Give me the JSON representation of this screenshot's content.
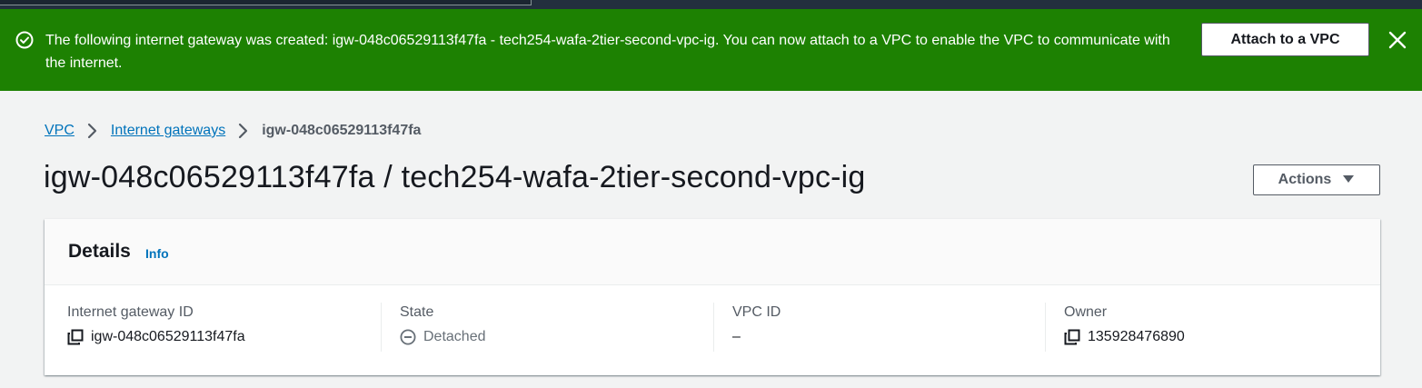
{
  "flash": {
    "message": "The following internet gateway was created: igw-048c06529113f47fa - tech254-wafa-2tier-second-vpc-ig. You can now attach to a VPC to enable the VPC to communicate with the internet.",
    "attach_label": "Attach to a VPC",
    "icon": "success-check-icon",
    "close_icon": "close-icon",
    "color": "#1d8102"
  },
  "breadcrumb": {
    "items": [
      {
        "label": "VPC"
      },
      {
        "label": "Internet gateways"
      }
    ],
    "current": "igw-048c06529113f47fa"
  },
  "page": {
    "title": "igw-048c06529113f47fa / tech254-wafa-2tier-second-vpc-ig",
    "actions_label": "Actions"
  },
  "details": {
    "title": "Details",
    "info_label": "Info",
    "fields": [
      {
        "label": "Internet gateway ID",
        "value": "igw-048c06529113f47fa",
        "icon": "copy-icon"
      },
      {
        "label": "State",
        "value": "Detached",
        "icon": "detached-status-icon"
      },
      {
        "label": "VPC ID",
        "value": "–"
      },
      {
        "label": "Owner",
        "value": "135928476890",
        "icon": "copy-icon"
      }
    ]
  }
}
